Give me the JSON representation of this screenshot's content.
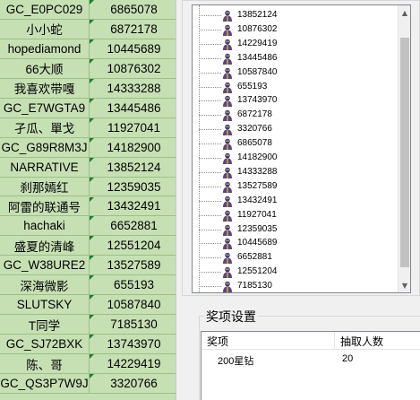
{
  "sheet": {
    "rows": [
      {
        "name": "GC_E0PC029",
        "number": "6865078"
      },
      {
        "name": "小小蛇",
        "number": "6872178"
      },
      {
        "name": "hopediamond",
        "number": "10445689"
      },
      {
        "name": "66大顺",
        "number": "10876302"
      },
      {
        "name": "我喜欢带嘎",
        "number": "14333288"
      },
      {
        "name": "GC_E7WGTA9",
        "number": "13445486"
      },
      {
        "name": "孑瓜、單戈",
        "number": "11927041"
      },
      {
        "name": "GC_G89R8M3J",
        "number": "14182900"
      },
      {
        "name": "NARRATIVE",
        "number": "13852124"
      },
      {
        "name": "刹那嫣红",
        "number": "12359035"
      },
      {
        "name": "阿雷的联通号",
        "number": "13432491"
      },
      {
        "name": "hachaki",
        "number": "6652881"
      },
      {
        "name": "盛夏的清峰",
        "number": "12551204"
      },
      {
        "name": "GC_W38URE2",
        "number": "13527589"
      },
      {
        "name": "深海微影",
        "number": "655193"
      },
      {
        "name": "SLUTSKY",
        "number": "10587840"
      },
      {
        "name": "T同学",
        "number": "7185130"
      },
      {
        "name": "GC_SJ72BXK",
        "number": "13743970"
      },
      {
        "name": "陈、哥",
        "number": "14229419"
      },
      {
        "name": "GC_QS3P7W9J",
        "number": "3320766"
      }
    ]
  },
  "tree": {
    "items": [
      "13852124",
      "10876302",
      "14229419",
      "13445486",
      "10587840",
      "655193",
      "13743970",
      "6872178",
      "3320766",
      "6865078",
      "14182900",
      "14333288",
      "13527589",
      "13432491",
      "11927041",
      "12359035",
      "10445689",
      "6652881",
      "12551204",
      "7185130"
    ],
    "icon": "user-icon"
  },
  "prize": {
    "legend": "奖项设置",
    "headers": [
      "奖项",
      "抽取人数"
    ],
    "rows": [
      {
        "award": "200星钻",
        "count": "20"
      }
    ]
  },
  "colors": {
    "sheet_bg": "#c6e0b4",
    "dialog_bg": "#f0f0f0"
  }
}
